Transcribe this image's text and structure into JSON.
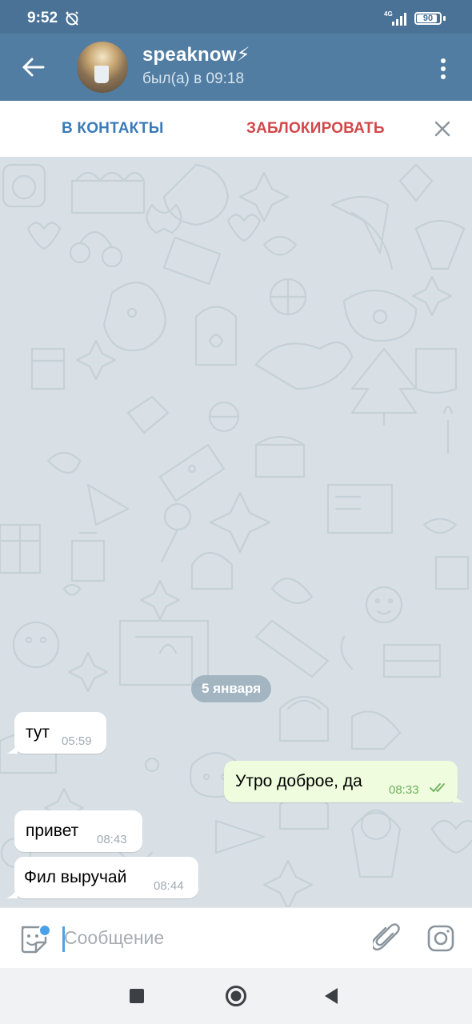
{
  "status_bar": {
    "time": "9:52",
    "network": "4G",
    "battery": "90",
    "battery_level": 0.9
  },
  "header": {
    "title": "speaknow⚡",
    "subtitle": "был(а) в 09:18"
  },
  "action_bar": {
    "add_contact": "В КОНТАКТЫ",
    "block": "ЗАБЛОКИРОВАТЬ"
  },
  "chat": {
    "date_separator": "5 января",
    "messages": [
      {
        "direction": "in",
        "text": "тут",
        "time": "05:59"
      },
      {
        "direction": "out",
        "text": "Утро доброе, да",
        "time": "08:33",
        "read": true
      },
      {
        "direction": "in",
        "text": "привет",
        "time": "08:43"
      },
      {
        "direction": "in",
        "text": "Фил выручай",
        "time": "08:44"
      }
    ]
  },
  "input": {
    "placeholder": "Сообщение"
  },
  "colors": {
    "header": "#517da2",
    "status_bar": "#4a7296",
    "outgoing_bubble": "#effdde",
    "block_red": "#d2474a",
    "accent_blue": "#3a7ab8"
  }
}
